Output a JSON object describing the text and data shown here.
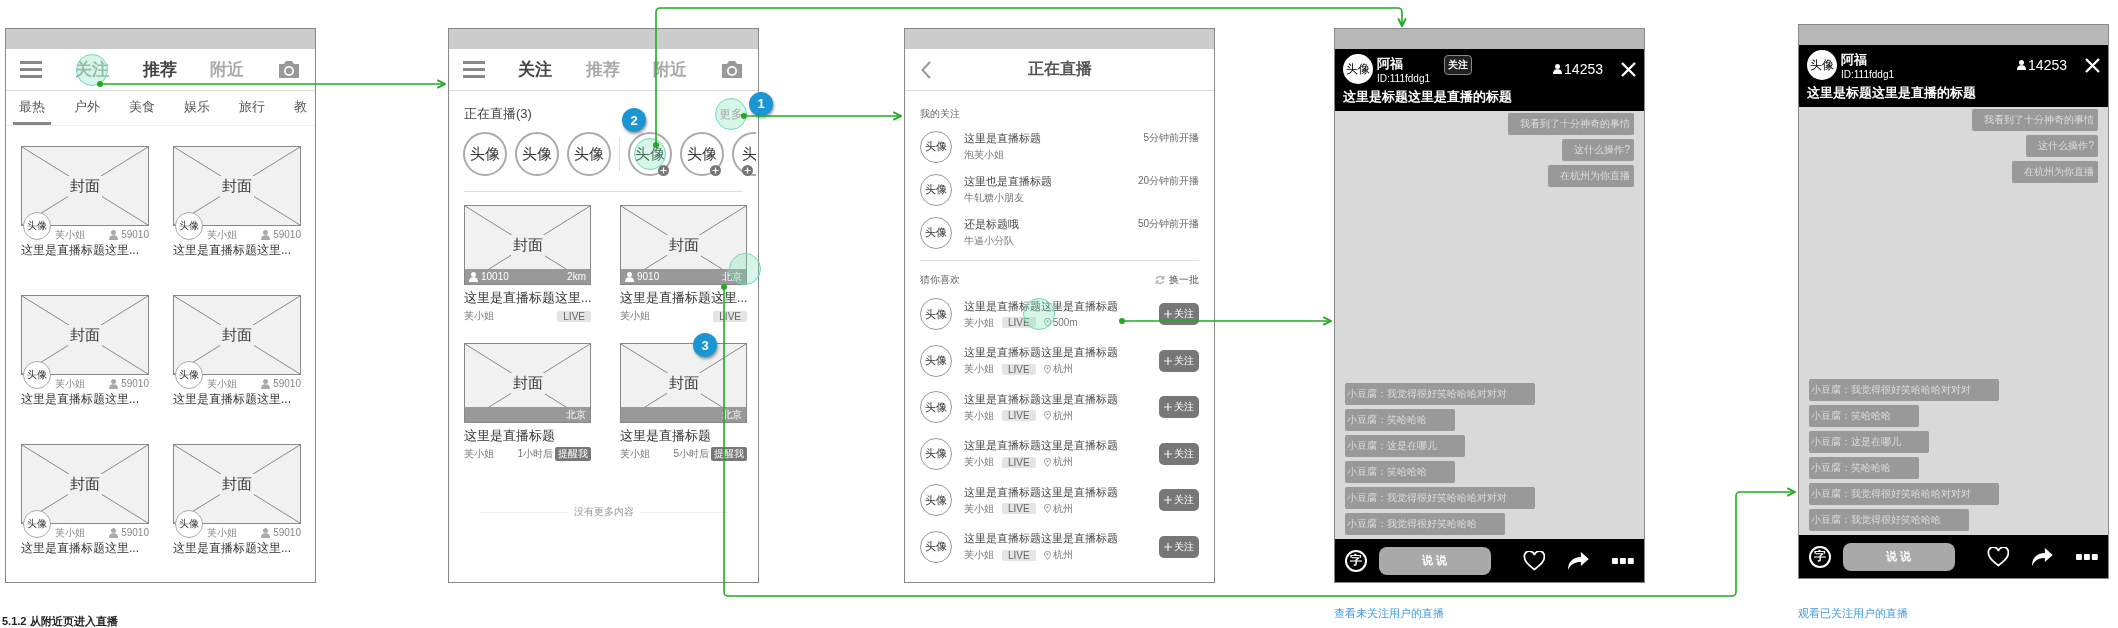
{
  "screens": [
    {
      "kind": "feed",
      "nav": [
        {
          "label": "关注",
          "selected": false,
          "tapped": true
        },
        {
          "label": "推荐",
          "selected": true,
          "tapped": false
        },
        {
          "label": "附近",
          "selected": false,
          "tapped": false
        }
      ],
      "categories": [
        {
          "label": "最热",
          "selected": true
        },
        {
          "label": "户外",
          "selected": false
        },
        {
          "label": "美食",
          "selected": false
        },
        {
          "label": "娱乐",
          "selected": false
        },
        {
          "label": "旅行",
          "selected": false
        },
        {
          "label": "教",
          "selected": false
        }
      ],
      "cards": [
        {
          "cover": "封面",
          "avatar": "头像",
          "user": "芙小姐",
          "viewers": "59010",
          "title": "这里是直播标题这里..."
        },
        {
          "cover": "封面",
          "avatar": "头像",
          "user": "芙小姐",
          "viewers": "59010",
          "title": "这里是直播标题这里..."
        },
        {
          "cover": "封面",
          "avatar": "头像",
          "user": "芙小姐",
          "viewers": "59010",
          "title": "这里是直播标题这里..."
        },
        {
          "cover": "封面",
          "avatar": "头像",
          "user": "芙小姐",
          "viewers": "59010",
          "title": "这里是直播标题这里..."
        },
        {
          "cover": "封面",
          "avatar": "头像",
          "user": "芙小姐",
          "viewers": "59010",
          "title": "这里是直播标题这里..."
        },
        {
          "cover": "封面",
          "avatar": "头像",
          "user": "芙小姐",
          "viewers": "59010",
          "title": "这里是直播标题这里..."
        }
      ]
    },
    {
      "kind": "following",
      "nav": [
        {
          "label": "关注",
          "selected": true,
          "tapped": false
        },
        {
          "label": "推荐",
          "selected": false,
          "tapped": false
        },
        {
          "label": "附近",
          "selected": false,
          "tapped": false
        }
      ],
      "live_header": "正在直播(3)",
      "more": {
        "label": "更多",
        "tapped": true,
        "marker": "1"
      },
      "avatars": [
        {
          "label": "头像",
          "kind": "live",
          "tapped": false
        },
        {
          "label": "头像",
          "kind": "live",
          "tapped": false
        },
        {
          "label": "头像",
          "kind": "live",
          "tapped": false
        },
        {
          "label": "头像",
          "kind": "suggested",
          "tapped": true,
          "marker": "2"
        },
        {
          "label": "头像",
          "kind": "suggested",
          "tapped": false
        },
        {
          "label": "头",
          "kind": "suggested",
          "tapped": false
        }
      ],
      "cards": [
        {
          "kind": "live",
          "cover": "封面",
          "viewers": "10010",
          "place": "2km",
          "title": "这里是直播标题这里...",
          "user": "芙小姐",
          "badge": "LIVE",
          "tapped": false
        },
        {
          "kind": "live",
          "cover": "封面",
          "viewers": "9010",
          "place": "北京",
          "title": "这里是直播标题这里...",
          "user": "芙小姐",
          "badge": "LIVE",
          "tapped": true,
          "marker": "3"
        },
        {
          "kind": "upcoming",
          "cover": "封面",
          "place": "北京",
          "title": "这里是直播标题",
          "user": "芙小姐",
          "time": "1小时后",
          "action": "提醒我",
          "tapped": false
        },
        {
          "kind": "upcoming",
          "cover": "封面",
          "place": "北京",
          "title": "这里是直播标题",
          "user": "芙小姐",
          "time": "5小时后",
          "action": "提醒我",
          "tapped": false
        }
      ],
      "footer": "没有更多内容"
    },
    {
      "kind": "live_list",
      "title": "正在直播",
      "followed_header": "我的关注",
      "followed": [
        {
          "avatar": "头像",
          "title": "这里是直播标题",
          "user": "泡芙小姐",
          "time": "5分钟前开播"
        },
        {
          "avatar": "头像",
          "title": "这里也是直播标题",
          "user": "牛轧糖小朋友",
          "time": "20分钟前开播"
        },
        {
          "avatar": "头像",
          "title": "还是标题哦",
          "user": "牛逼小分队",
          "time": "50分钟前开播"
        }
      ],
      "suggest_header": "猜你喜欢",
      "refresh": "换一批",
      "suggested": [
        {
          "avatar": "头像",
          "title": "这里是直播标题这里是直播标题",
          "user": "芙小姐",
          "badge": "LIVE",
          "location": "500m",
          "button": "关注",
          "tapped": true
        },
        {
          "avatar": "头像",
          "title": "这里是直播标题这里是直播标题",
          "user": "芙小姐",
          "badge": "LIVE",
          "location": "杭州",
          "button": "关注",
          "tapped": false
        },
        {
          "avatar": "头像",
          "title": "这里是直播标题这里是直播标题",
          "user": "芙小姐",
          "badge": "LIVE",
          "location": "杭州",
          "button": "关注",
          "tapped": false
        },
        {
          "avatar": "头像",
          "title": "这里是直播标题这里是直播标题",
          "user": "芙小姐",
          "badge": "LIVE",
          "location": "杭州",
          "button": "关注",
          "tapped": false
        },
        {
          "avatar": "头像",
          "title": "这里是直播标题这里是直播标题",
          "user": "芙小姐",
          "badge": "LIVE",
          "location": "杭州",
          "button": "关注",
          "tapped": false
        },
        {
          "avatar": "头像",
          "title": "这里是直播标题这里是直播标题",
          "user": "芙小姐",
          "badge": "LIVE",
          "location": "杭州",
          "button": "关注",
          "tapped": false
        }
      ]
    },
    {
      "kind": "room",
      "avatar": "头像",
      "name": "阿福",
      "id": "ID:111fddg1",
      "follow": "关注",
      "viewers": "14253",
      "title": "这里是标题这里是直播的标题",
      "pinned": [
        "我看到了十分神奇的事情",
        "这什么操作?",
        "在杭州为你直播"
      ],
      "chat": [
        "小豆腐：我觉得很好笑哈哈哈对对对",
        "小豆腐：笑哈哈哈",
        "小豆腐：这是在哪儿",
        "小豆腐：笑哈哈哈",
        "小豆腐：我觉得很好笑哈哈哈对对对",
        "小豆腐：我觉得很好笑哈哈哈"
      ],
      "text_key": "字",
      "say": "说 说",
      "caption": "查看未关注用户的直播"
    },
    {
      "kind": "room",
      "avatar": "头像",
      "name": "阿福",
      "id": "ID:111fddg1",
      "viewers": "14253",
      "title": "这里是标题这里是直播的标题",
      "pinned": [
        "我看到了十分神奇的事情",
        "这什么操作?",
        "在杭州为你直播"
      ],
      "chat": [
        "小豆腐：我觉得很好笑哈哈哈对对对",
        "小豆腐：笑哈哈哈",
        "小豆腐：这是在哪儿",
        "小豆腐：笑哈哈哈",
        "小豆腐：我觉得很好笑哈哈哈对对对",
        "小豆腐：我觉得很好笑哈哈哈"
      ],
      "text_key": "字",
      "say": "说 说",
      "caption": "观看已关注用户的直播"
    }
  ],
  "heading": "5.1.2 从附近页进入直播"
}
